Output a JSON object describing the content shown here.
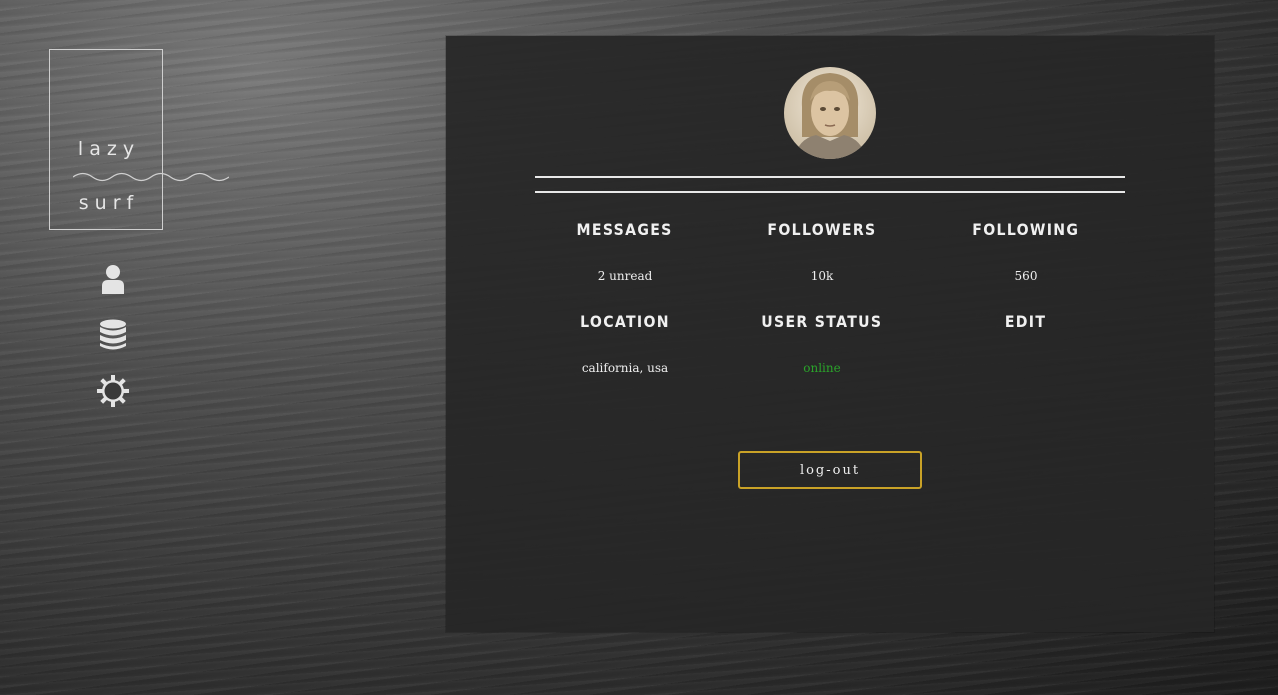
{
  "brand": {
    "line1": "lazy",
    "line2": "surf"
  },
  "sidebar": {
    "items": [
      {
        "icon": "user-icon"
      },
      {
        "icon": "database-icon"
      },
      {
        "icon": "gear-icon"
      }
    ]
  },
  "profile": {
    "stats": [
      {
        "label": "MESSAGES",
        "value": "2 unread"
      },
      {
        "label": "FOLLOWERS",
        "value": "10k"
      },
      {
        "label": "FOLLOWING",
        "value": "560"
      },
      {
        "label": "LOCATION",
        "value": "california, usa"
      },
      {
        "label": "USER STATUS",
        "value": "online"
      },
      {
        "label": "EDIT",
        "value": ""
      }
    ],
    "logout_label": "log-out"
  },
  "colors": {
    "accent": "#c9a227",
    "online": "#2aa32a",
    "panel": "#262626"
  }
}
